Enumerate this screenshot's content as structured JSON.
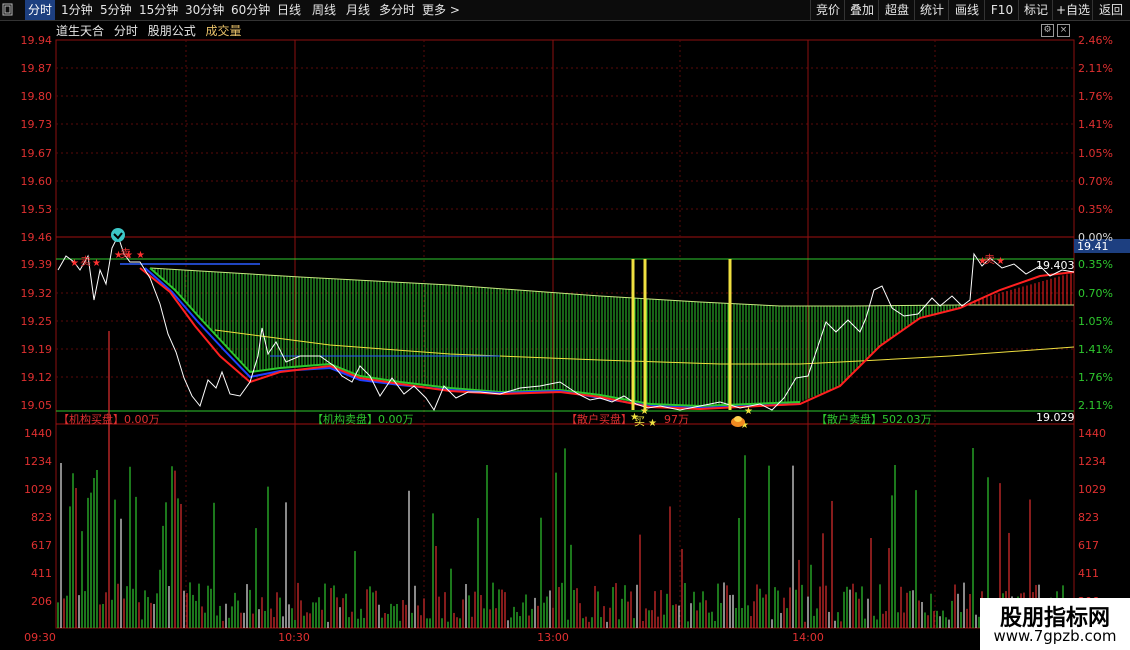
{
  "toolbar": {
    "left_icon": "window-icon",
    "tabs": [
      "分时",
      "1分钟",
      "5分钟",
      "15分钟",
      "30分钟",
      "60分钟",
      "日线",
      "周线",
      "月线",
      "多分时",
      "更多 >"
    ],
    "active_tab": "分时",
    "right_buttons": [
      "竞价",
      "叠加",
      "超盘",
      "统计",
      "画线",
      "F10",
      "标记",
      "+自选",
      "返回"
    ]
  },
  "subbar": {
    "stock_name": "道生天合",
    "mode": "分时",
    "formula": "股朋公式",
    "volume_label": "成交量"
  },
  "price_axis": {
    "left_labels": [
      "19.94",
      "19.87",
      "19.80",
      "19.73",
      "19.67",
      "19.60",
      "19.53",
      "19.46",
      "19.39",
      "19.32",
      "19.25",
      "19.19",
      "19.12",
      "19.05"
    ],
    "right_labels": [
      "2.46%",
      "2.11%",
      "1.76%",
      "1.41%",
      "1.05%",
      "0.70%",
      "0.35%",
      "0.00%",
      "0.35%",
      "0.70%",
      "1.05%",
      "1.41%",
      "1.76%",
      "2.11%"
    ],
    "current_price_tag": "19.41",
    "line_value_label": "19.403",
    "bottom_value_label": "19.029"
  },
  "indicators": {
    "inst_buy": "【机构买盘】0.00万",
    "inst_sell": "【机构卖盘】0.00万",
    "retail_buy": "【散户买盘】",
    "retail_buy_value": "97万",
    "retail_sell": "【散户卖盘】502.03万",
    "sell_marker": "卖",
    "buy_marker": "买"
  },
  "volume_axis": {
    "labels": [
      "1440",
      "1234",
      "1029",
      "823",
      "617",
      "411",
      "206"
    ]
  },
  "time_axis": {
    "labels": [
      "09:30",
      "10:30",
      "13:00",
      "14:00"
    ]
  },
  "watermark": {
    "title": "股朋指标网",
    "url": "www.7gpzb.com"
  },
  "colors": {
    "red_grid": "#8b1010",
    "price_text": "#e03030",
    "green": "#2ec82e",
    "yellow": "#f0e040",
    "white_line": "#ffffff",
    "blue": "#2040ff",
    "red_line": "#ff2020",
    "current_tag_bg": "#1d3f80"
  }
}
